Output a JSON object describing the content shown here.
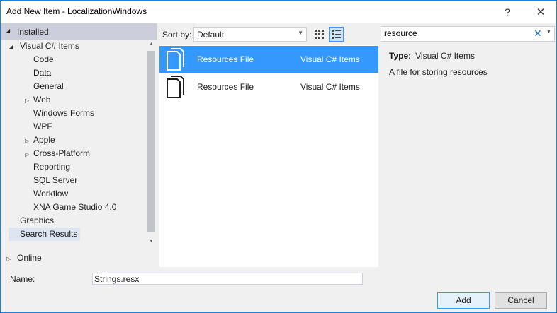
{
  "window": {
    "title": "Add New Item - LocalizationWindows",
    "help": "?",
    "close": "✕"
  },
  "left_pane": {
    "installed_label": "Installed",
    "tree": [
      {
        "label": "Visual C# Items",
        "expander": "◢",
        "level": 0
      },
      {
        "label": "Code",
        "expander": "",
        "level": 1
      },
      {
        "label": "Data",
        "expander": "",
        "level": 1
      },
      {
        "label": "General",
        "expander": "",
        "level": 1
      },
      {
        "label": "Web",
        "expander": "▷",
        "level": 1
      },
      {
        "label": "Windows Forms",
        "expander": "",
        "level": 1
      },
      {
        "label": "WPF",
        "expander": "",
        "level": 1
      },
      {
        "label": "Apple",
        "expander": "▷",
        "level": 1
      },
      {
        "label": "Cross-Platform",
        "expander": "▷",
        "level": 1
      },
      {
        "label": "Reporting",
        "expander": "",
        "level": 1
      },
      {
        "label": "SQL Server",
        "expander": "",
        "level": 1
      },
      {
        "label": "Workflow",
        "expander": "",
        "level": 1
      },
      {
        "label": "XNA Game Studio 4.0",
        "expander": "",
        "level": 1
      },
      {
        "label": "Graphics",
        "expander": "",
        "level": 0
      },
      {
        "label": "Search Results",
        "expander": "",
        "level": 0,
        "selected": true
      }
    ],
    "online_label": "Online"
  },
  "toolbar": {
    "sort_label": "Sort by:",
    "sort_value": "Default",
    "search_value": "resource",
    "search_clear": "✕"
  },
  "templates": [
    {
      "name": "Resources File",
      "category": "Visual C# Items",
      "selected": true
    },
    {
      "name": "Resources File",
      "category": "Visual C# Items",
      "selected": false
    }
  ],
  "details": {
    "type_label": "Type:",
    "type_value": "Visual C# Items",
    "description": "A file for storing resources"
  },
  "footer": {
    "name_label": "Name:",
    "name_value": "Strings.resx",
    "add_label": "Add",
    "cancel_label": "Cancel"
  },
  "colors": {
    "selection": "#3399ff",
    "installed_header": "#cccedb",
    "accent_border": "#1883d7"
  }
}
